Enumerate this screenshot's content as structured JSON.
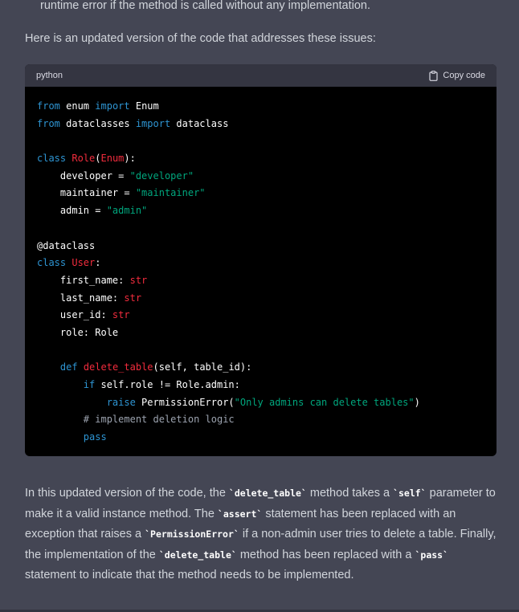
{
  "message": {
    "top_fragment": "runtime error if the method is called without any implementation.",
    "intro": "Here is an updated version of the code that addresses these issues:"
  },
  "code_block": {
    "language": "python",
    "copy_label": "Copy code",
    "lines": [
      [
        {
          "t": "from",
          "c": "kw"
        },
        {
          "t": " enum ",
          "c": ""
        },
        {
          "t": "import",
          "c": "kw"
        },
        {
          "t": " Enum",
          "c": ""
        }
      ],
      [
        {
          "t": "from",
          "c": "kw"
        },
        {
          "t": " dataclasses ",
          "c": ""
        },
        {
          "t": "import",
          "c": "kw"
        },
        {
          "t": " dataclass",
          "c": ""
        }
      ],
      [],
      [
        {
          "t": "class",
          "c": "kw"
        },
        {
          "t": " ",
          "c": ""
        },
        {
          "t": "Role",
          "c": "cls"
        },
        {
          "t": "(",
          "c": ""
        },
        {
          "t": "Enum",
          "c": "cls"
        },
        {
          "t": "):",
          "c": ""
        }
      ],
      [
        {
          "t": "    developer = ",
          "c": ""
        },
        {
          "t": "\"developer\"",
          "c": "str"
        }
      ],
      [
        {
          "t": "    maintainer = ",
          "c": ""
        },
        {
          "t": "\"maintainer\"",
          "c": "str"
        }
      ],
      [
        {
          "t": "    admin = ",
          "c": ""
        },
        {
          "t": "\"admin\"",
          "c": "str"
        }
      ],
      [],
      [
        {
          "t": "@dataclass",
          "c": ""
        }
      ],
      [
        {
          "t": "class",
          "c": "kw"
        },
        {
          "t": " ",
          "c": ""
        },
        {
          "t": "User",
          "c": "cls"
        },
        {
          "t": ":",
          "c": ""
        }
      ],
      [
        {
          "t": "    first_name: ",
          "c": ""
        },
        {
          "t": "str",
          "c": "cls"
        }
      ],
      [
        {
          "t": "    last_name: ",
          "c": ""
        },
        {
          "t": "str",
          "c": "cls"
        }
      ],
      [
        {
          "t": "    user_id: ",
          "c": ""
        },
        {
          "t": "str",
          "c": "cls"
        }
      ],
      [
        {
          "t": "    role: Role",
          "c": ""
        }
      ],
      [],
      [
        {
          "t": "    ",
          "c": ""
        },
        {
          "t": "def",
          "c": "kw"
        },
        {
          "t": " ",
          "c": ""
        },
        {
          "t": "delete_table",
          "c": "cls"
        },
        {
          "t": "(self, table_id):",
          "c": ""
        }
      ],
      [
        {
          "t": "        ",
          "c": ""
        },
        {
          "t": "if",
          "c": "kw"
        },
        {
          "t": " self.role != Role.admin:",
          "c": ""
        }
      ],
      [
        {
          "t": "            ",
          "c": ""
        },
        {
          "t": "raise",
          "c": "kw"
        },
        {
          "t": " PermissionError(",
          "c": ""
        },
        {
          "t": "\"Only admins can delete tables\"",
          "c": "str"
        },
        {
          "t": ")",
          "c": ""
        }
      ],
      [
        {
          "t": "        # implement deletion logic",
          "c": "cm"
        }
      ],
      [
        {
          "t": "        ",
          "c": ""
        },
        {
          "t": "pass",
          "c": "kw"
        }
      ]
    ]
  },
  "explanation": {
    "segments": [
      {
        "t": "In this updated version of the code, the ",
        "code": false
      },
      {
        "t": "`delete_table`",
        "code": true
      },
      {
        "t": " method takes a ",
        "code": false
      },
      {
        "t": "`self`",
        "code": true
      },
      {
        "t": " parameter to make it a valid instance method. The ",
        "code": false
      },
      {
        "t": "`assert`",
        "code": true
      },
      {
        "t": " statement has been replaced with an exception that raises a ",
        "code": false
      },
      {
        "t": "`PermissionError`",
        "code": true
      },
      {
        "t": " if a non-admin user tries to delete a table. Finally, the implementation of the ",
        "code": false
      },
      {
        "t": "`delete_table`",
        "code": true
      },
      {
        "t": " method has been replaced with a ",
        "code": false
      },
      {
        "t": "`pass`",
        "code": true
      },
      {
        "t": " statement to indicate that the method needs to be implemented.",
        "code": false
      }
    ]
  }
}
